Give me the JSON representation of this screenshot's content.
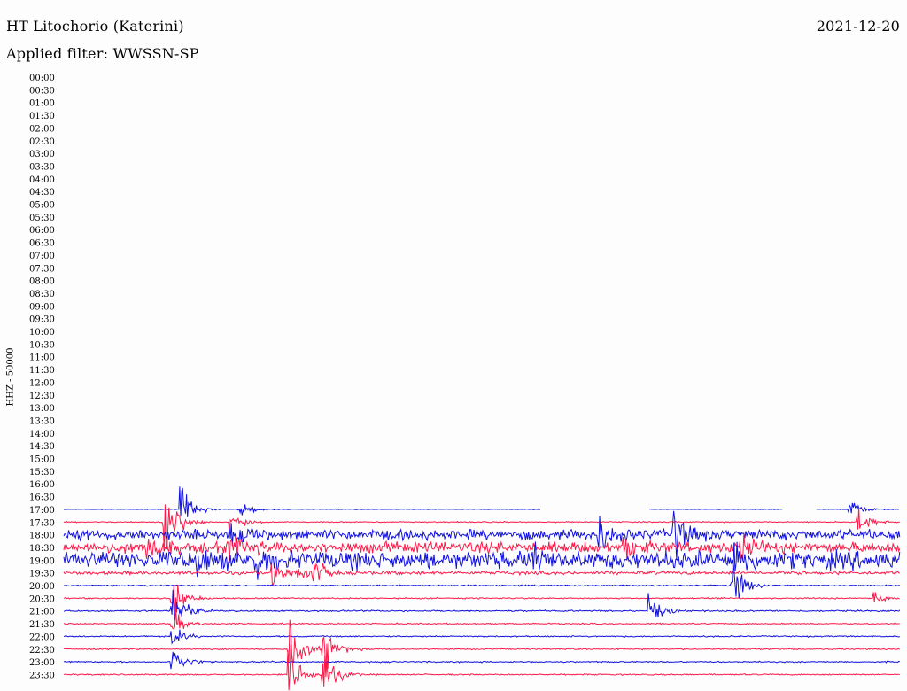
{
  "header": {
    "station": "HT Litochorio (Katerini)",
    "filter": "Applied filter: WWSSN-SP",
    "date": "2021-12-20",
    "channel_label": "HHZ - 50000"
  },
  "chart_data": {
    "type": "line",
    "title": "HT Litochorio (Katerini)",
    "subtitle": "Applied filter: WWSSN-SP",
    "date": "2021-12-20",
    "ylabel": "HHZ - 50000",
    "rows": [
      "00:00",
      "00:30",
      "01:00",
      "01:30",
      "02:00",
      "02:30",
      "03:00",
      "03:30",
      "04:00",
      "04:30",
      "05:00",
      "05:30",
      "06:00",
      "06:30",
      "07:00",
      "07:30",
      "08:00",
      "08:30",
      "09:00",
      "09:30",
      "10:00",
      "10:30",
      "11:00",
      "11:30",
      "12:00",
      "12:30",
      "13:00",
      "13:30",
      "14:00",
      "14:30",
      "15:00",
      "15:30",
      "16:00",
      "16:30",
      "17:00",
      "17:30",
      "18:00",
      "18:30",
      "19:00",
      "19:30",
      "20:00",
      "20:30",
      "21:00",
      "21:30",
      "22:00",
      "22:30",
      "23:00",
      "23:30"
    ],
    "x_range_minutes": [
      0,
      30
    ],
    "series_colors": [
      "#1010e0",
      "#ff1848"
    ],
    "trace_rows": [
      {
        "row": "17:00",
        "color": "#1010e0",
        "noise": 0.25,
        "segments": [
          [
            0.0,
            0.57
          ],
          [
            0.7,
            0.86
          ],
          [
            0.9,
            1.0
          ]
        ],
        "events": [
          {
            "t": 0.14,
            "amp": 22
          },
          {
            "t": 0.21,
            "amp": 8
          },
          {
            "t": 0.94,
            "amp": 10
          }
        ]
      },
      {
        "row": "17:30",
        "color": "#ff1848",
        "noise": 0.5,
        "segments": [
          [
            0.0,
            1.0
          ]
        ],
        "events": [
          {
            "t": 0.12,
            "amp": 48
          },
          {
            "t": 0.2,
            "amp": 10
          },
          {
            "t": 0.95,
            "amp": 14
          }
        ]
      },
      {
        "row": "18:00",
        "color": "#1010e0",
        "noise": 4.5,
        "segments": [
          [
            0.0,
            1.0
          ]
        ],
        "events": [
          {
            "t": 0.2,
            "amp": 14
          },
          {
            "t": 0.64,
            "amp": 18
          },
          {
            "t": 0.73,
            "amp": 22
          }
        ]
      },
      {
        "row": "18:30",
        "color": "#ff1848",
        "noise": 5.0,
        "segments": [
          [
            0.0,
            1.0
          ]
        ],
        "events": [
          {
            "t": 0.1,
            "amp": 12
          },
          {
            "t": 0.2,
            "amp": 14
          },
          {
            "t": 0.67,
            "amp": 10
          },
          {
            "t": 0.81,
            "amp": 12
          }
        ]
      },
      {
        "row": "19:00",
        "color": "#1010e0",
        "noise": 8.0,
        "segments": [
          [
            0.0,
            1.0
          ]
        ],
        "events": [
          {
            "t": 0.16,
            "amp": 10
          },
          {
            "t": 0.23,
            "amp": 14
          },
          {
            "t": 0.56,
            "amp": 14
          },
          {
            "t": 0.8,
            "amp": 20
          }
        ]
      },
      {
        "row": "19:30",
        "color": "#ff1848",
        "noise": 1.5,
        "segments": [
          [
            0.0,
            1.0
          ]
        ],
        "events": [
          {
            "t": 0.25,
            "amp": 14
          },
          {
            "t": 0.28,
            "amp": 12
          },
          {
            "t": 0.3,
            "amp": 12
          }
        ]
      },
      {
        "row": "20:00",
        "color": "#1010e0",
        "noise": 0.6,
        "segments": [
          [
            0.0,
            1.0
          ]
        ],
        "events": [
          {
            "t": 0.8,
            "amp": 24
          }
        ]
      },
      {
        "row": "20:30",
        "color": "#ff1848",
        "noise": 0.6,
        "segments": [
          [
            0.0,
            1.0
          ]
        ],
        "events": [
          {
            "t": 0.13,
            "amp": 20
          },
          {
            "t": 0.97,
            "amp": 6
          }
        ]
      },
      {
        "row": "21:00",
        "color": "#1010e0",
        "noise": 0.7,
        "segments": [
          [
            0.0,
            1.0
          ]
        ],
        "events": [
          {
            "t": 0.13,
            "amp": 30
          },
          {
            "t": 0.7,
            "amp": 16
          }
        ]
      },
      {
        "row": "21:30",
        "color": "#ff1848",
        "noise": 0.6,
        "segments": [
          [
            0.0,
            1.0
          ]
        ],
        "events": [
          {
            "t": 0.13,
            "amp": 14
          }
        ]
      },
      {
        "row": "22:00",
        "color": "#1010e0",
        "noise": 0.6,
        "segments": [
          [
            0.0,
            1.0
          ]
        ],
        "events": [
          {
            "t": 0.13,
            "amp": 10
          }
        ]
      },
      {
        "row": "22:30",
        "color": "#ff1848",
        "noise": 0.6,
        "segments": [
          [
            0.0,
            1.0
          ]
        ],
        "events": [
          {
            "t": 0.27,
            "amp": 36
          },
          {
            "t": 0.31,
            "amp": 26
          }
        ]
      },
      {
        "row": "23:00",
        "color": "#1010e0",
        "noise": 0.6,
        "segments": [
          [
            0.0,
            1.0
          ]
        ],
        "events": [
          {
            "t": 0.13,
            "amp": 16
          }
        ]
      },
      {
        "row": "23:30",
        "color": "#ff1848",
        "noise": 0.6,
        "segments": [
          [
            0.0,
            1.0
          ]
        ],
        "events": [
          {
            "t": 0.27,
            "amp": 30
          },
          {
            "t": 0.31,
            "amp": 26
          }
        ]
      }
    ]
  }
}
